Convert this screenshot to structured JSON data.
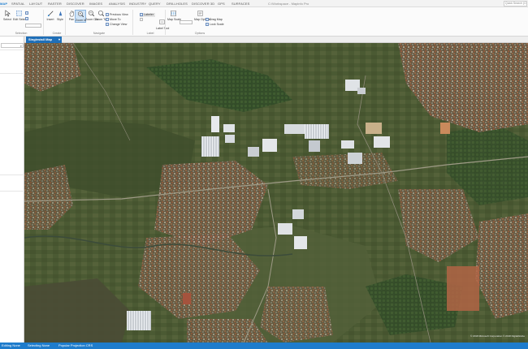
{
  "app": {
    "title": "C:\\Workspace - Mapinfo Pro"
  },
  "menu": {
    "tabs": [
      {
        "label": "MAP",
        "active": true
      },
      {
        "label": "SPATIAL"
      },
      {
        "label": "LAYOUT"
      },
      {
        "label": "RASTER"
      },
      {
        "label": "DISCOVER"
      },
      {
        "label": "IMAGES"
      },
      {
        "label": "ANALYSIS"
      },
      {
        "label": "INDUSTRY"
      },
      {
        "label": "QUERY"
      },
      {
        "label": "DRILLHOLES"
      },
      {
        "label": "DISCOVER 3D"
      },
      {
        "label": "GPS"
      },
      {
        "label": "SURFACES"
      }
    ],
    "search_placeholder": "Quick Search (Ctrl+Q)"
  },
  "ribbon": {
    "selection": {
      "select": "Select",
      "edit_select": "Edit Select",
      "group": "Selection"
    },
    "create": {
      "insert": "Insert",
      "style": "Style",
      "group": "Create"
    },
    "navigate": {
      "pan": "Pan",
      "zoom_in": "Zoom In",
      "zoom_out": "Zoom Out",
      "zoom_to": "Zoom To",
      "previous_view": "Previous View",
      "move_to": "Move To",
      "change_view": "Change View",
      "group": "Navigate"
    },
    "label": {
      "labeler": "Labeler",
      "label_tool": "Label Tool",
      "group": "Label"
    },
    "options": {
      "map_scale": "Map Scale",
      "map_options": "Map Options",
      "drag_map": "Drag Map",
      "lock_scale": "Lock Scale",
      "group": "Options"
    }
  },
  "view": {
    "map_tab": "Singlestail Map"
  },
  "statusbar": {
    "left": "Editing None",
    "middle": "Selecting None",
    "right": "Popular Projection CRS"
  },
  "map": {
    "attribution": "© 2018 Microsoft Corporation © 2018 DigitalGlobe"
  },
  "icons": {
    "select": "arrow-cursor-icon",
    "pan": "hand-icon",
    "zoom": "magnifier-icon",
    "search": "search-icon"
  },
  "colors": {
    "accent": "#1f7fd0",
    "statusbar": "#1e7ccc",
    "map_tab": "#1f6fb8"
  }
}
